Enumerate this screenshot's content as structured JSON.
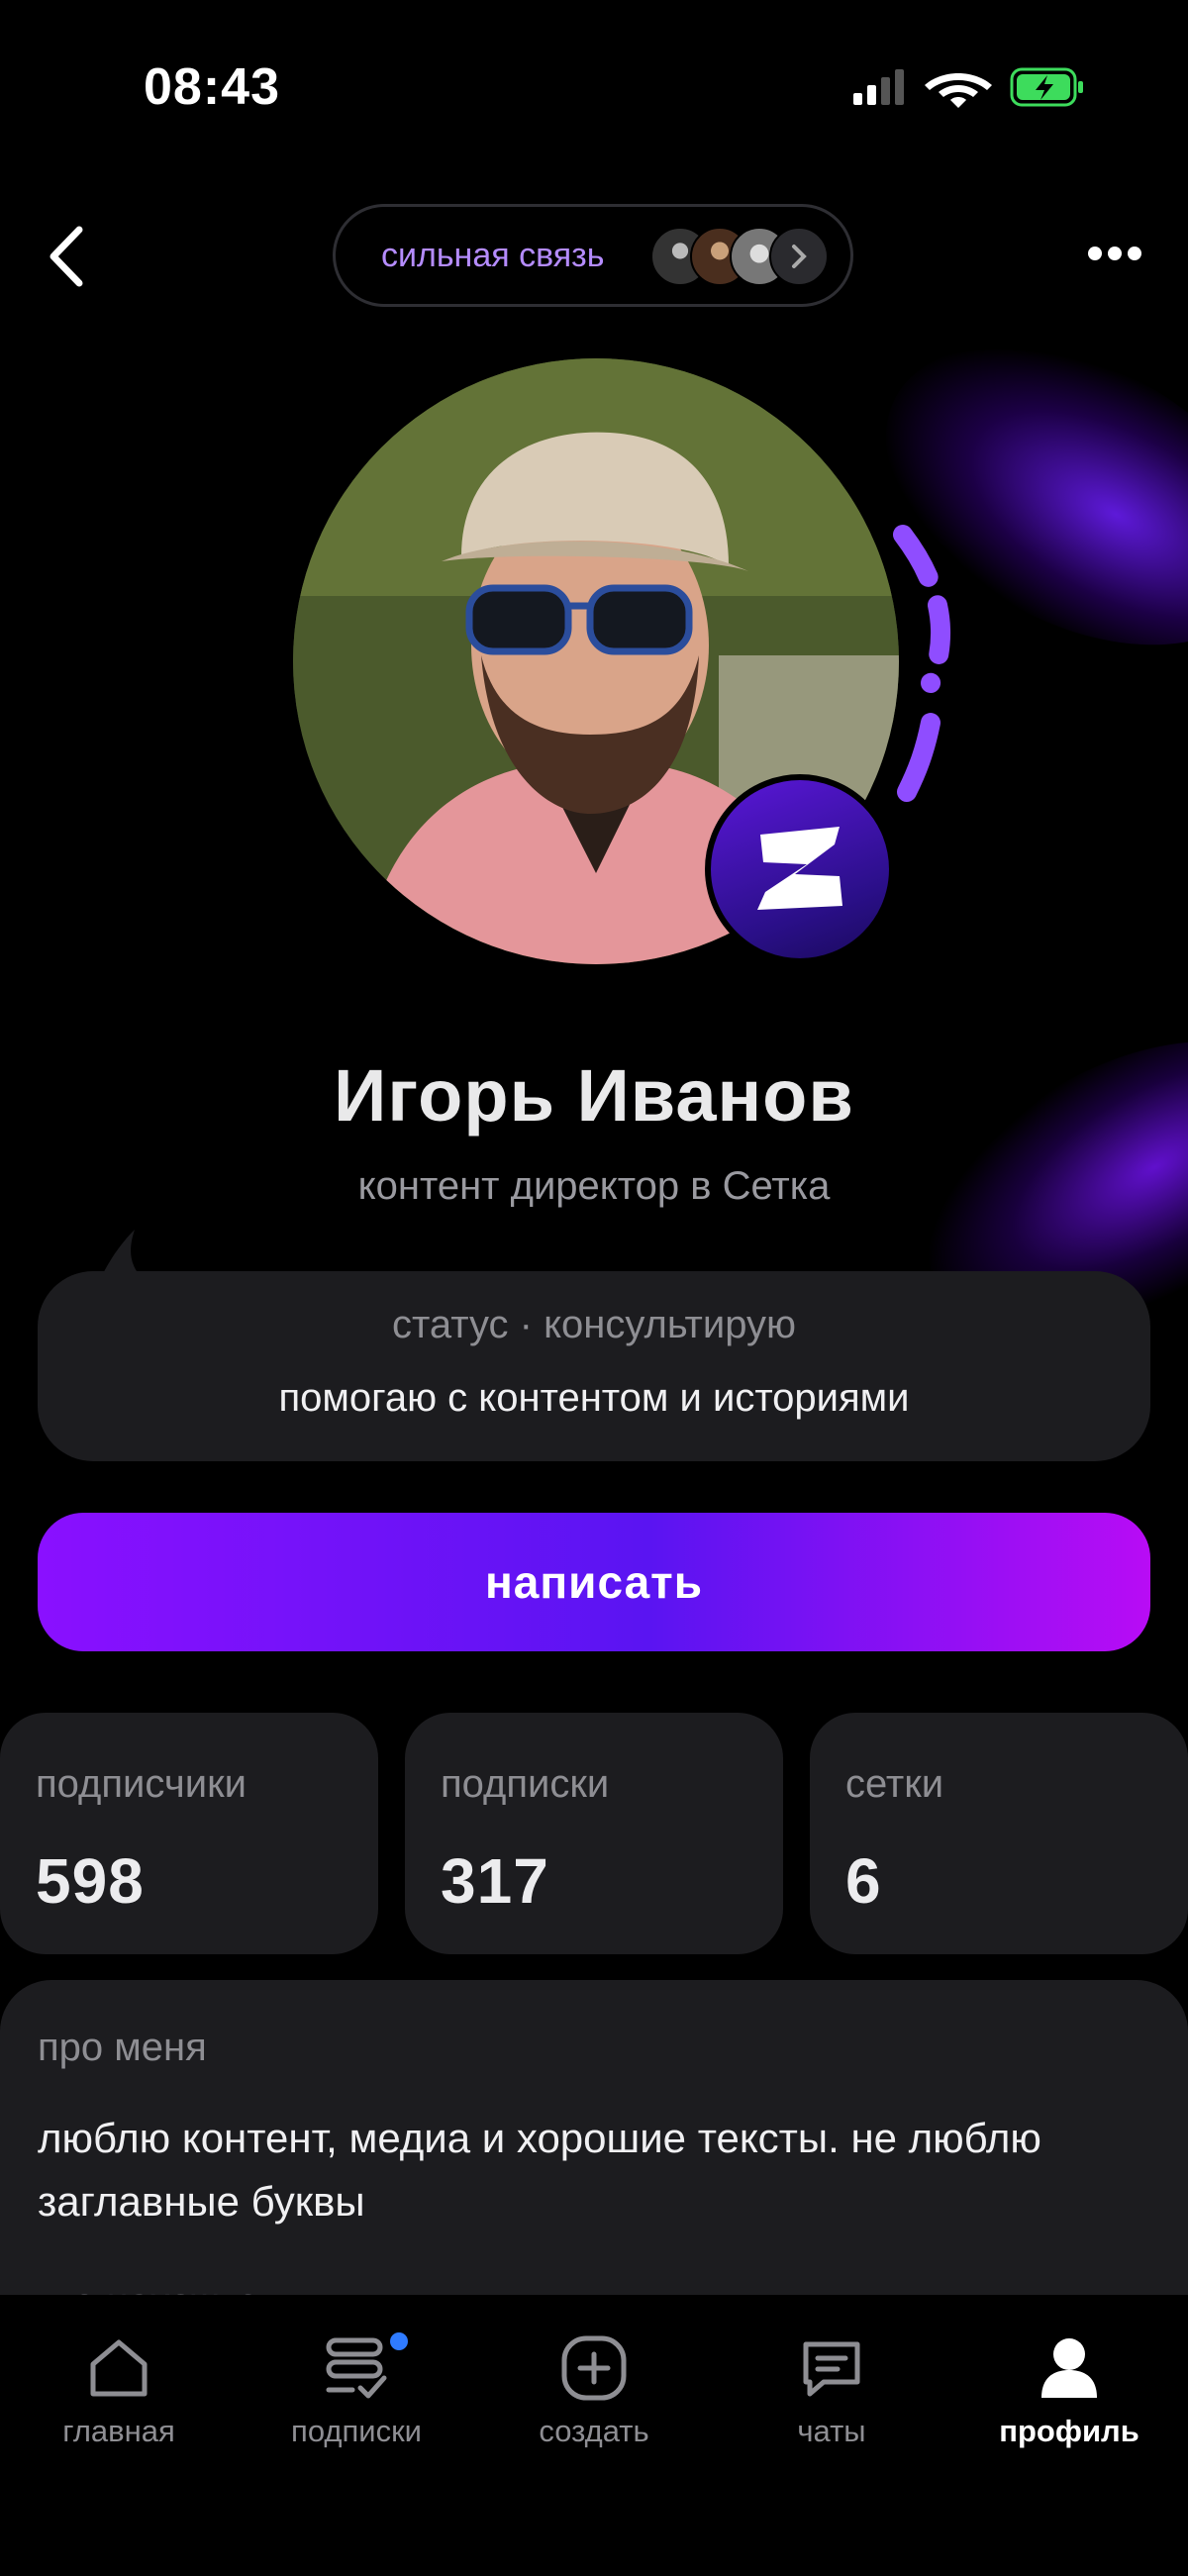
{
  "status_bar": {
    "time": "08:43"
  },
  "header": {
    "connection_label": "сильная связь"
  },
  "profile": {
    "name": "Игорь Иванов",
    "role": "контент директор в Сетка"
  },
  "status": {
    "heading": "статус · консультирую",
    "text": "помогаю с контентом и историями"
  },
  "cta": {
    "label": "написать"
  },
  "stats": [
    {
      "label": "подписчики",
      "value": "598"
    },
    {
      "label": "подписки",
      "value": "317"
    },
    {
      "label": "сетки",
      "value": "6"
    }
  ],
  "about": {
    "title": "про меня",
    "text": "люблю контент, медиа и хорошие тексты. не люблю заглавные буквы",
    "next_section": "где нахожусь"
  },
  "tabs": [
    {
      "label": "главная",
      "icon": "home-icon"
    },
    {
      "label": "подписки",
      "icon": "subscriptions-icon"
    },
    {
      "label": "создать",
      "icon": "create-icon"
    },
    {
      "label": "чаты",
      "icon": "chat-icon"
    },
    {
      "label": "профиль",
      "icon": "profile-icon",
      "active": true
    }
  ],
  "colors": {
    "accent": "#8a10ff",
    "connection_text": "#b58cff",
    "card_bg": "#1c1c1f",
    "notification_dot": "#2f7bff"
  }
}
